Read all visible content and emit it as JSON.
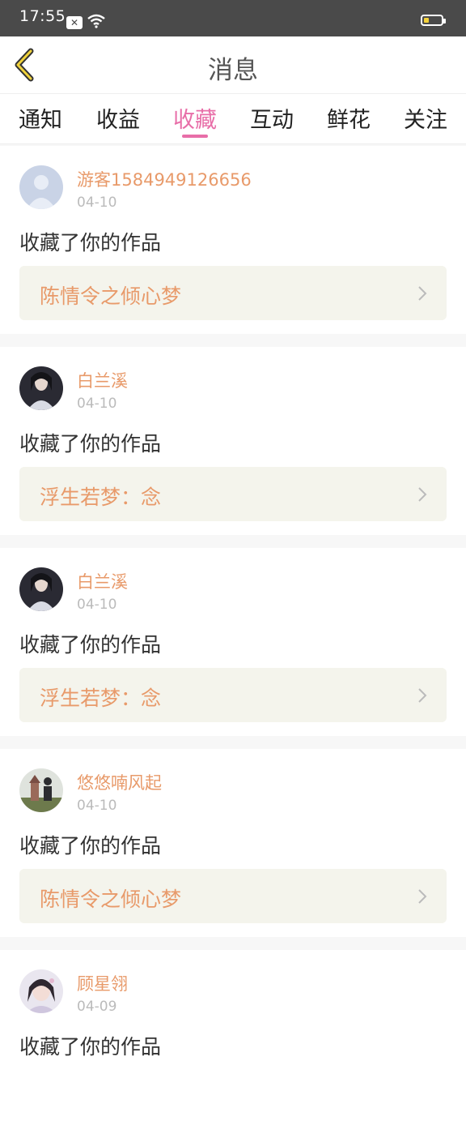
{
  "status": {
    "time": "17:55"
  },
  "header": {
    "title": "消息"
  },
  "tabs": [
    {
      "label": "通知"
    },
    {
      "label": "收益"
    },
    {
      "label": "收藏",
      "active": true
    },
    {
      "label": "互动"
    },
    {
      "label": "鲜花"
    },
    {
      "label": "关注"
    }
  ],
  "colors": {
    "accent": "#e86ea8",
    "name": "#e89a6a",
    "work_bg": "#f4f4ec"
  },
  "messages": [
    {
      "user": "游客1584949126656",
      "date": "04-10",
      "action": "收藏了你的作品",
      "work": "陈情令之倾心梦"
    },
    {
      "user": "白兰溪",
      "date": "04-10",
      "action": "收藏了你的作品",
      "work": "浮生若梦：念"
    },
    {
      "user": "白兰溪",
      "date": "04-10",
      "action": "收藏了你的作品",
      "work": "浮生若梦：念"
    },
    {
      "user": "悠悠喃风起",
      "date": "04-10",
      "action": "收藏了你的作品",
      "work": "陈情令之倾心梦"
    },
    {
      "user": "顾星翎",
      "date": "04-09",
      "action": "收藏了你的作品",
      "work": ""
    }
  ]
}
